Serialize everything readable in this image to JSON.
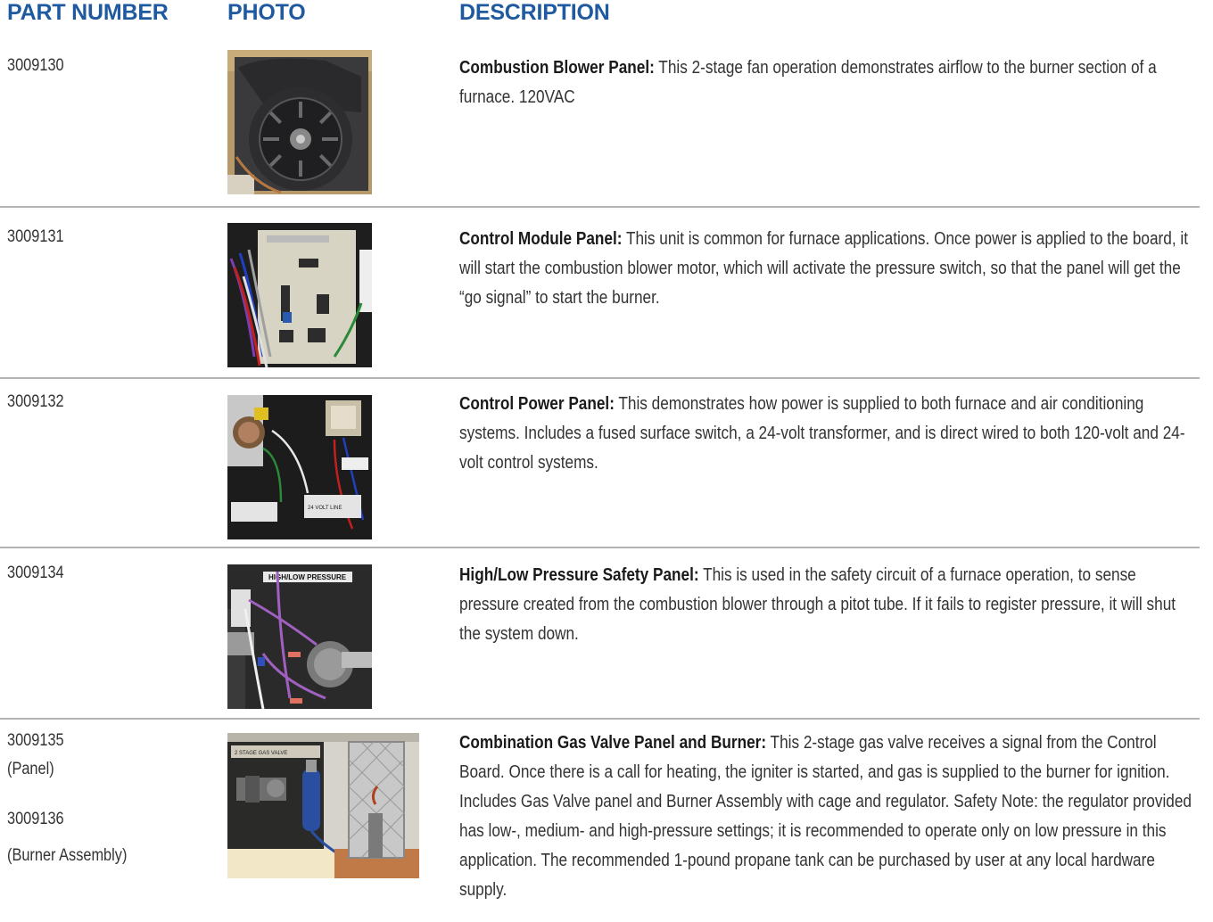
{
  "headers": {
    "part_number": "PART NUMBER",
    "photo": "PHOTO",
    "description": "DESCRIPTION"
  },
  "rows": [
    {
      "part_number": "3009130",
      "title": "Combustion Blower Panel:",
      "text": " This 2-stage fan operation  demonstrates airflow to the burner section of a furnace. 120VAC"
    },
    {
      "part_number": "3009131",
      "title": "Control Module Panel:",
      "text": " This unit is common for furnace  applications. Once power is applied to the board, it will start the combustion blower motor, which will activate the pressure switch, so that the panel will get the “go signal” to start the burner."
    },
    {
      "part_number": "3009132",
      "title": "Control Power Panel:",
      "text": " This demonstrates how power is supplied to both furnace and air conditioning systems. Includes a fused surface switch, a 24-volt transformer, and is direct wired to both 120-volt and 24-volt control systems."
    },
    {
      "part_number": "3009134",
      "title": "High/Low Pressure Safety Panel:",
      "text": " This is used in the safety circuit of a furnace operation, to sense pressure created from the combustion blower through a pitot tube. If it fails to register pressure, it will shut the system down."
    },
    {
      "part_number": "3009135",
      "part_note": "(Panel)",
      "part_number_2": "3009136",
      "part_note_2": "(Burner Assembly)",
      "title": "Combination Gas Valve Panel and Burner:",
      "text": " This 2-stage gas valve receives a signal from the Control Board. Once there is a call for heating,  the igniter is started, and gas is supplied to the burner for ignition. Includes Gas Valve panel and Burner Assembly with cage and regulator.  Safety Note: the regulator provided has low-, medium- and high-pressure settings; it is recommended to operate only on low pressure in this application. The recommended 1-pound propane tank can be purchased by user at any local hardware supply."
    }
  ],
  "photo_labels": {
    "pressure_label": "HIGH/LOW PRESSURE",
    "gas_valve_label": "2 STAGE GAS VALVE",
    "terminal_label": "24 VOLT LINE"
  }
}
